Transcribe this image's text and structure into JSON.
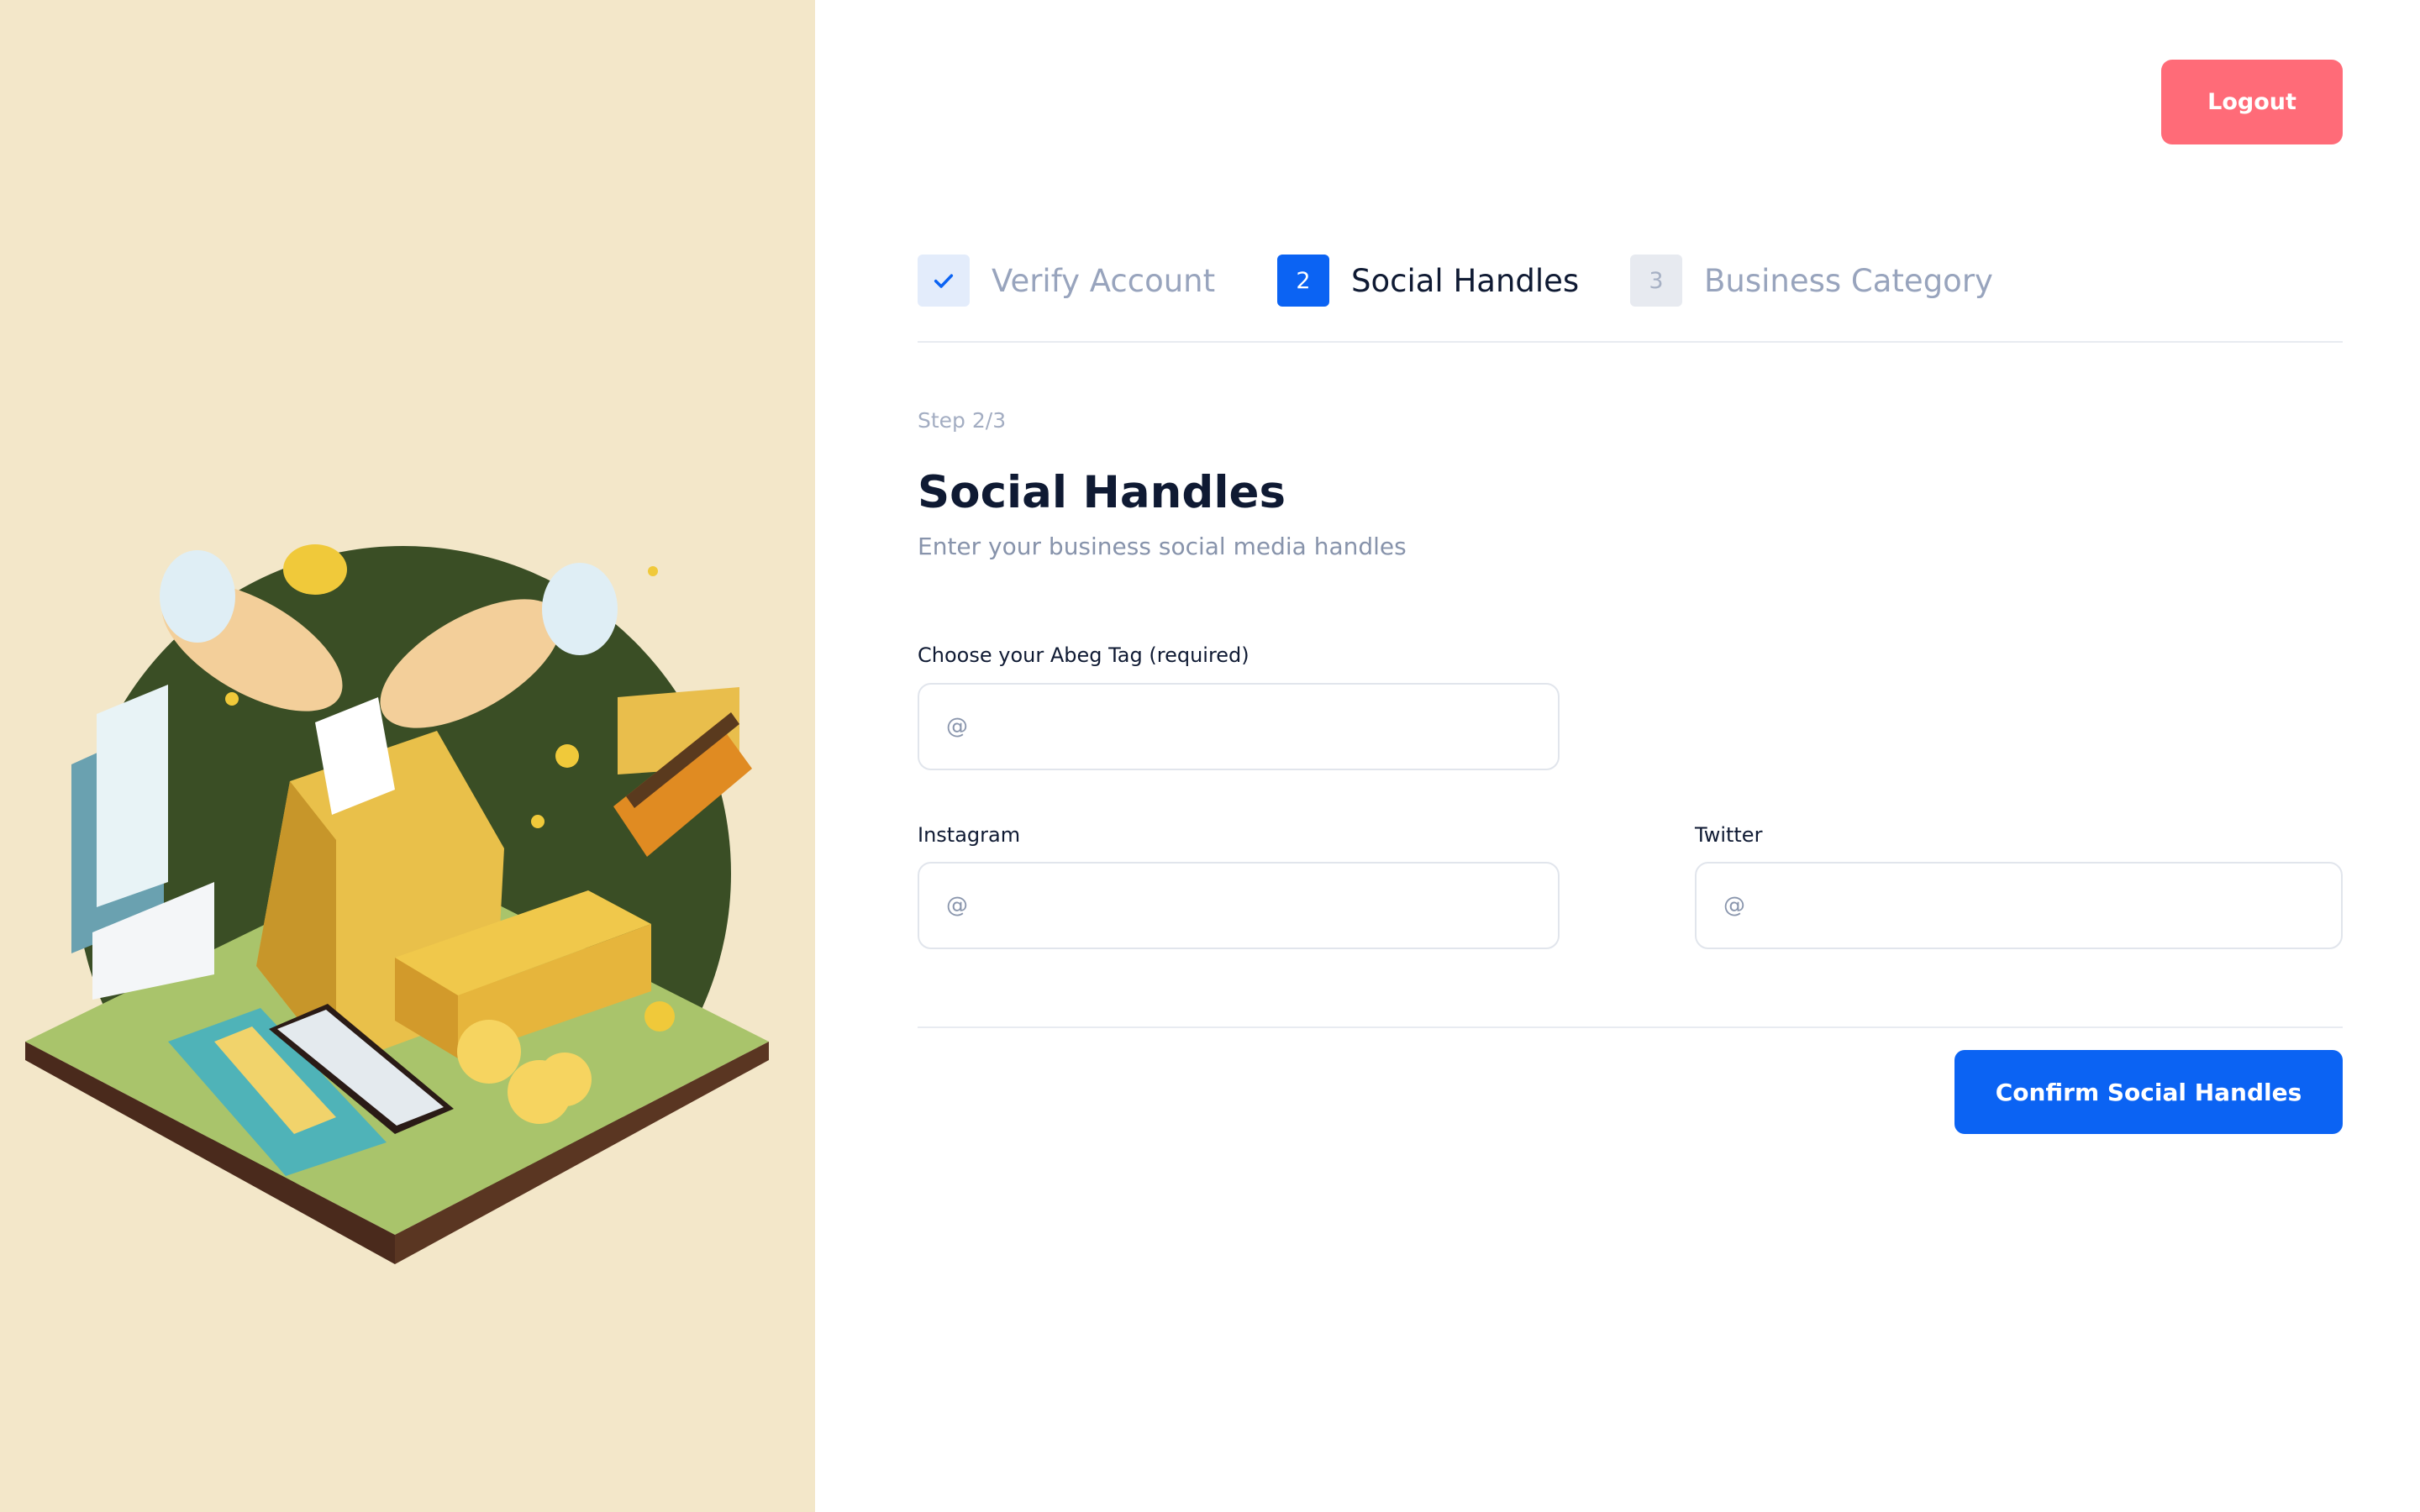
{
  "header": {
    "logout_label": "Logout"
  },
  "stepper": {
    "steps": [
      {
        "number": "",
        "label": "Verify Account",
        "state": "completed"
      },
      {
        "number": "2",
        "label": "Social Handles",
        "state": "active"
      },
      {
        "number": "3",
        "label": "Business Category",
        "state": "pending"
      }
    ]
  },
  "main": {
    "step_count": "Step 2/3",
    "title": "Social Handles",
    "subtitle": "Enter your business social media handles"
  },
  "form": {
    "abeg_tag": {
      "label": "Choose your Abeg Tag (required)",
      "placeholder": "@",
      "value": ""
    },
    "instagram": {
      "label": "Instagram",
      "placeholder": "@",
      "value": ""
    },
    "twitter": {
      "label": "Twitter",
      "placeholder": "@",
      "value": ""
    },
    "submit_label": "Confirm Social Handles"
  },
  "colors": {
    "primary": "#0b63f3",
    "logout": "#ff6b78",
    "left_panel_bg": "#f3e7c9",
    "illustration_dark_green": "#3a4e25"
  }
}
